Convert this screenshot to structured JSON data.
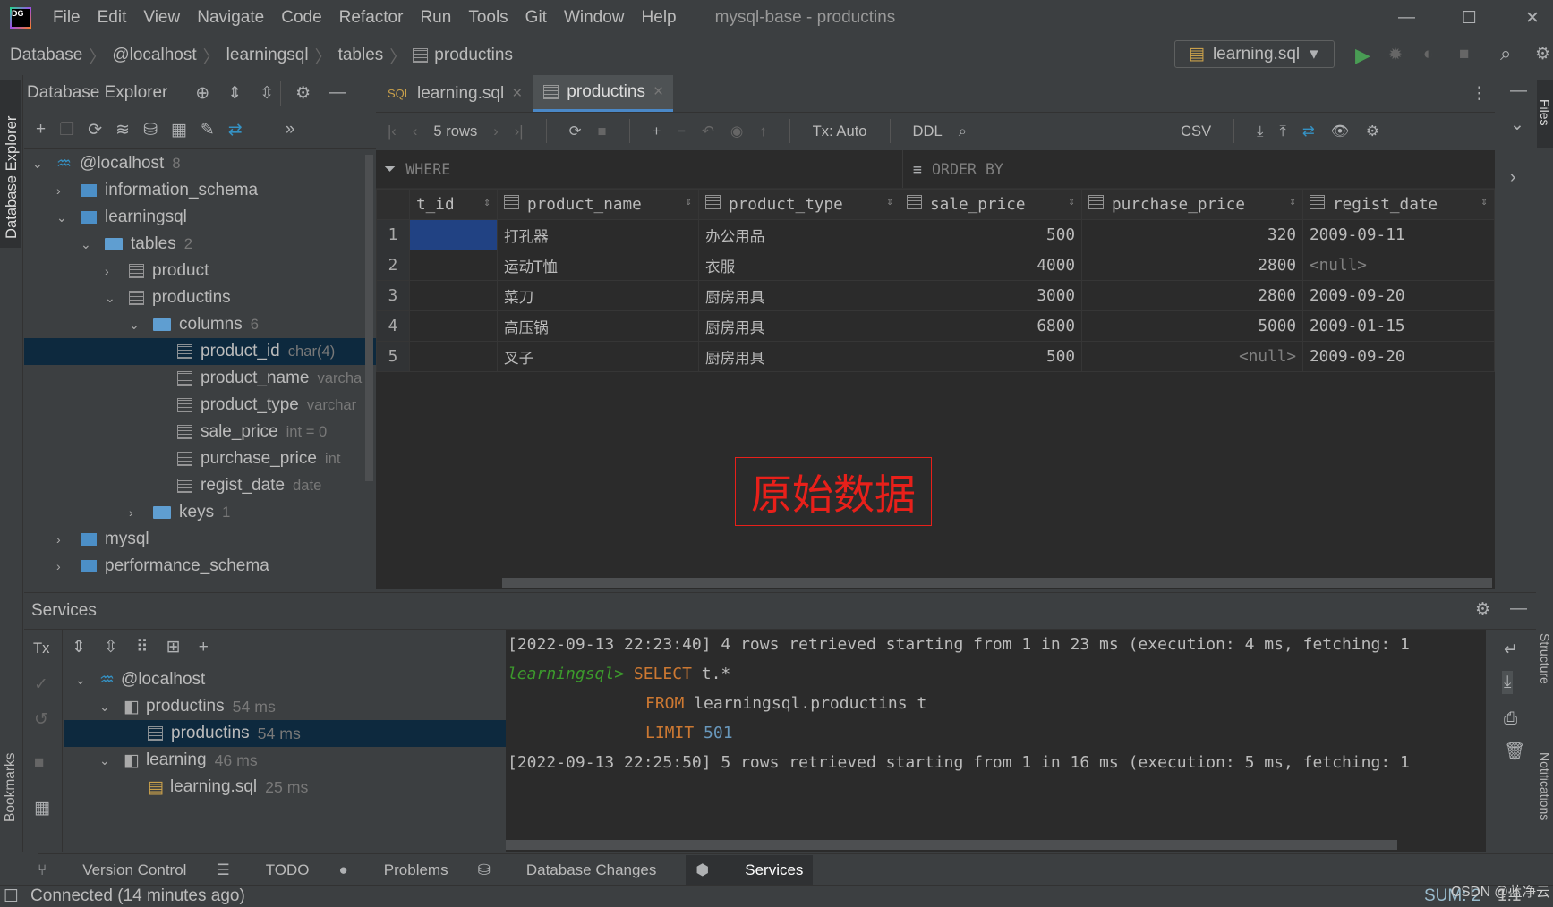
{
  "window": {
    "title": "mysql-base - productins",
    "menu": [
      "File",
      "Edit",
      "View",
      "Navigate",
      "Code",
      "Refactor",
      "Run",
      "Tools",
      "Git",
      "Window",
      "Help"
    ]
  },
  "breadcrumb": [
    "Database",
    "@localhost",
    "learningsql",
    "tables",
    "productins"
  ],
  "run_config": "learning.sql",
  "explorer": {
    "title": "Database Explorer",
    "side_label": "Database Explorer",
    "tree": [
      {
        "label": "@localhost",
        "badge": "8"
      },
      {
        "label": "information_schema"
      },
      {
        "label": "learningsql"
      },
      {
        "label": "tables",
        "badge": "2"
      },
      {
        "label": "product"
      },
      {
        "label": "productins"
      },
      {
        "label": "columns",
        "badge": "6"
      },
      {
        "label": "product_id",
        "type": "char(4)"
      },
      {
        "label": "product_name",
        "type": "varcha"
      },
      {
        "label": "product_type",
        "type": "varchar"
      },
      {
        "label": "sale_price",
        "type": "int = 0"
      },
      {
        "label": "purchase_price",
        "type": "int"
      },
      {
        "label": "regist_date",
        "type": "date"
      },
      {
        "label": "keys",
        "badge": "1"
      },
      {
        "label": "mysql"
      },
      {
        "label": "performance_schema"
      }
    ]
  },
  "tabs": [
    {
      "label": "learning.sql",
      "active": false
    },
    {
      "label": "productins",
      "active": true
    }
  ],
  "grid_toolbar": {
    "rows": "5 rows",
    "tx": "Tx: Auto",
    "ddl": "DDL",
    "export": "CSV"
  },
  "filter": {
    "where": "WHERE",
    "order_by": "ORDER BY"
  },
  "grid": {
    "columns": [
      "t_id",
      "product_name",
      "product_type",
      "sale_price",
      "purchase_price",
      "regist_date"
    ],
    "rows": [
      [
        "1",
        "",
        "打孔器",
        "办公用品",
        "500",
        "320",
        "2009-09-11"
      ],
      [
        "2",
        "",
        "运动T恤",
        "衣服",
        "4000",
        "2800",
        "<null>"
      ],
      [
        "3",
        "",
        "菜刀",
        "厨房用具",
        "3000",
        "2800",
        "2009-09-20"
      ],
      [
        "4",
        "",
        "高压锅",
        "厨房用具",
        "6800",
        "5000",
        "2009-01-15"
      ],
      [
        "5",
        "",
        "叉子",
        "厨房用具",
        "500",
        "<null>",
        "2009-09-20"
      ]
    ]
  },
  "annotation": "原始数据",
  "services": {
    "title": "Services",
    "tx": "Tx",
    "tree": [
      {
        "label": "@localhost"
      },
      {
        "label": "productins",
        "time": "54 ms"
      },
      {
        "label": "productins",
        "time": "54 ms"
      },
      {
        "label": "learning",
        "time": "46 ms"
      },
      {
        "label": "learning.sql",
        "time": "25 ms"
      }
    ],
    "console": {
      "line1": "[2022-09-13 22:23:40] 4 rows retrieved starting from 1 in 23 ms (execution: 4 ms, fetching: 1",
      "prompt": "learningsql>",
      "select": "SELECT",
      "select_rest": " t.*",
      "from": "FROM",
      "from_rest": " learningsql.productins t",
      "limit": "LIMIT",
      "limit_val": "501",
      "line2": "[2022-09-13 22:25:50] 5 rows retrieved starting from 1 in 16 ms (execution: 5 ms, fetching: 1"
    }
  },
  "bottom_tabs": [
    "Version Control",
    "TODO",
    "Problems",
    "Database Changes",
    "Services"
  ],
  "status": {
    "text": "Connected (14 minutes ago)",
    "sum": "SUM: 2",
    "pos": "1:1",
    "watermark": "CSDN @蓝净云"
  },
  "side": {
    "bookmarks": "Bookmarks",
    "files": "Files",
    "structure": "Structure",
    "notifications": "Notifications"
  },
  "colors": {
    "accent": "#4a88c7",
    "selection": "#0d293e",
    "cell_selected": "#214283",
    "annotation": "#e8201a"
  }
}
